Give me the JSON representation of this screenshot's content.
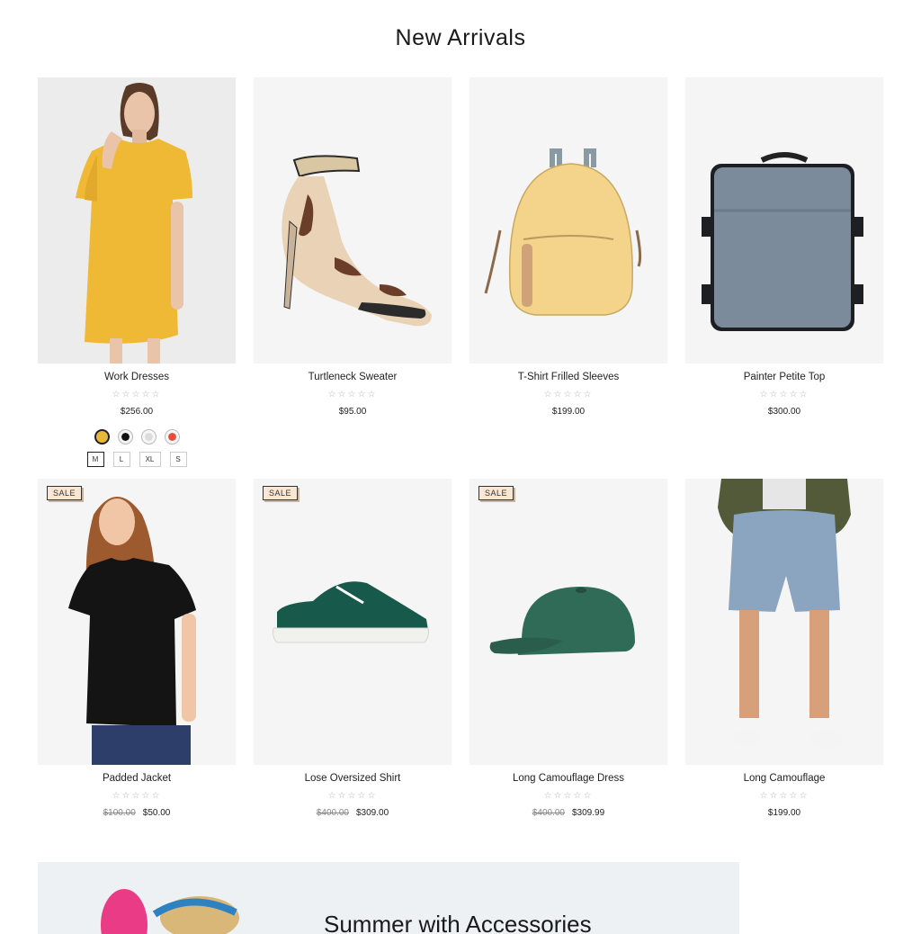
{
  "section": {
    "title": "New Arrivals"
  },
  "products": [
    {
      "name": "Work Dresses",
      "rating_stars": "☆☆☆☆☆",
      "price": "$256.00",
      "swatches": [
        "#e7b93a",
        "#111111",
        "#eaeaea",
        "#e84c3d"
      ],
      "sizes": [
        "M",
        "L",
        "XL",
        "S"
      ],
      "selected_size": "M"
    },
    {
      "name": "Turtleneck Sweater",
      "rating_stars": "☆☆☆☆☆",
      "price": "$95.00"
    },
    {
      "name": "T-Shirt Frilled Sleeves",
      "rating_stars": "☆☆☆☆☆",
      "price": "$199.00"
    },
    {
      "name": "Painter Petite Top",
      "rating_stars": "☆☆☆☆☆",
      "price": "$300.00"
    },
    {
      "name": "Padded Jacket",
      "rating_stars": "☆☆☆☆☆",
      "badge": "SALE",
      "old_price": "$100.00",
      "price": "$50.00"
    },
    {
      "name": "Lose Oversized Shirt",
      "rating_stars": "☆☆☆☆☆",
      "badge": "SALE",
      "old_price": "$400.00",
      "price": "$309.00"
    },
    {
      "name": "Long Camouflage Dress",
      "rating_stars": "☆☆☆☆☆",
      "badge": "SALE",
      "old_price": "$400.00",
      "price": "$309.99"
    },
    {
      "name": "Long Camouflage",
      "rating_stars": "☆☆☆☆☆",
      "price": "$199.00"
    }
  ],
  "banner": {
    "title": "Summer with Accessories"
  }
}
